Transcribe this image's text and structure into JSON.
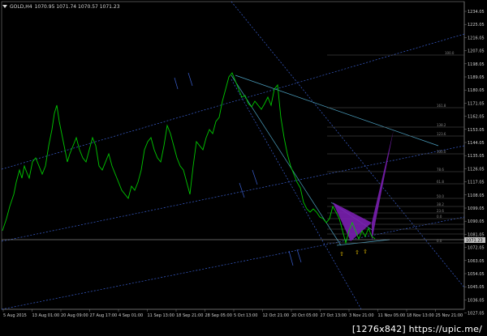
{
  "window": {
    "symbol_label": "GOLD,H4",
    "quote_values": "1070.95 1071.74 1070.57 1071.23"
  },
  "price_axis": {
    "ticks": [
      "1234.05",
      "1225.05",
      "1216.05",
      "1207.05",
      "1198.05",
      "1189.05",
      "1180.05",
      "1171.05",
      "1162.05",
      "1153.05",
      "1144.05",
      "1135.05",
      "1126.05",
      "1117.05",
      "1108.05",
      "1099.05",
      "1090.05",
      "1081.05",
      "1072.05",
      "1063.05",
      "1054.05",
      "1045.05",
      "1036.05",
      "1027.05"
    ],
    "current_price": "1071.23",
    "current_price_color": "#c0c0c0"
  },
  "time_axis": {
    "ticks": [
      "5 Aug 2015",
      "13 Aug 01:00",
      "20 Aug 09:00",
      "27 Aug 17:00",
      "4 Sep 01:00",
      "11 Sep 13:00",
      "18 Sep 21:00",
      "28 Sep 05:00",
      "5 Oct 13:00",
      "12 Oct 21:00",
      "20 Oct 05:00",
      "27 Oct 13:00",
      "3 Nov 21:00",
      "11 Nov 05:00",
      "18 Nov 13:00",
      "25 Nov 21:00"
    ]
  },
  "fibonacci_levels": [
    "100.0",
    "161.8",
    "138.2",
    "123.6",
    "100.0",
    "78.6",
    "61.8",
    "50.0",
    "38.2",
    "23.6",
    "0.0",
    "0.0"
  ],
  "pattern_markers": [
    "up-arrow",
    "up-arrow",
    "up-arrow"
  ],
  "colors": {
    "background": "#000000",
    "candles": "#00c800",
    "channel_lines": "#3a5fd0",
    "pattern_fill": "#7a1fb0",
    "marker": "#e8c000"
  },
  "watermark": "[1276x842] https://upic.me/"
}
